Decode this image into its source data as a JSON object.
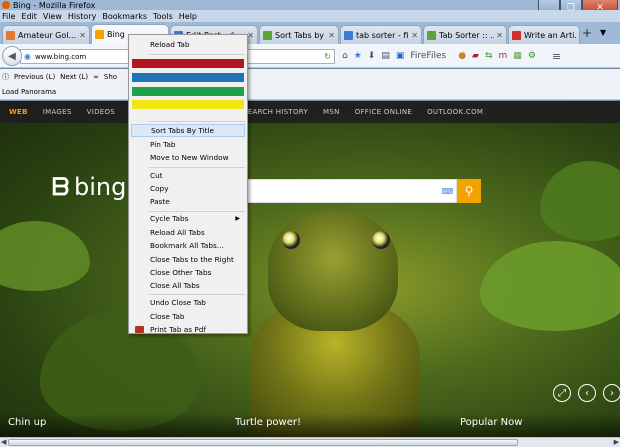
{
  "window": {
    "title": "Bing - Mozilla Firefox"
  },
  "menubar": [
    "File",
    "Edit",
    "View",
    "History",
    "Bookmarks",
    "Tools",
    "Help"
  ],
  "tabs": [
    {
      "label": "Amateur Gol...",
      "fav_color": "#e57a2c"
    },
    {
      "label": "Bing",
      "fav_color": "#f4a200"
    },
    {
      "label": "Edit Post ‹ d...",
      "fav_color": "#3a7bd5"
    },
    {
      "label": "Sort Tabs by ...",
      "fav_color": "#5aa43a"
    },
    {
      "label": "tab sorter - fi...",
      "fav_color": "#3a7bd5"
    },
    {
      "label": "Tab Sorter :: ...",
      "fav_color": "#5aa43a"
    },
    {
      "label": "Write an Arti...",
      "fav_color": "#d02e2e"
    }
  ],
  "navbar": {
    "url": "www.bing.com",
    "firefiles_label": "FireFiles"
  },
  "toolbar2": {
    "previous": "Previous (L)",
    "next": "Next (L)",
    "show": "Sho"
  },
  "toolbar3": {
    "load_panorama": "Load Panorama"
  },
  "bing": {
    "nav": [
      "WEB",
      "IMAGES",
      "VIDEOS",
      "SEARCH HISTORY",
      "MSN",
      "OFFICE ONLINE",
      "OUTLOOK.COM"
    ],
    "logo_text": "bing",
    "captions": [
      "Chin up",
      "Turtle power!",
      "Popular Now"
    ]
  },
  "context_menu": {
    "reload_tab": "Reload Tab",
    "color_bars": [
      "#b0161c",
      "#1f74b8",
      "#1fa04a",
      "#f2e716"
    ],
    "items_group1": [
      "Sort Tabs By Title",
      "Pin Tab",
      "Move to New Window"
    ],
    "items_group2": [
      "Cut",
      "Copy",
      "Paste"
    ],
    "items_group3": [
      "Cycle Tabs",
      "Reload All Tabs",
      "Bookmark All Tabs...",
      "Close Tabs to the Right",
      "Close Other Tabs",
      "Close All Tabs"
    ],
    "items_group4": [
      "Undo Close Tab",
      "Close Tab",
      "Print Tab as Pdf"
    ]
  }
}
